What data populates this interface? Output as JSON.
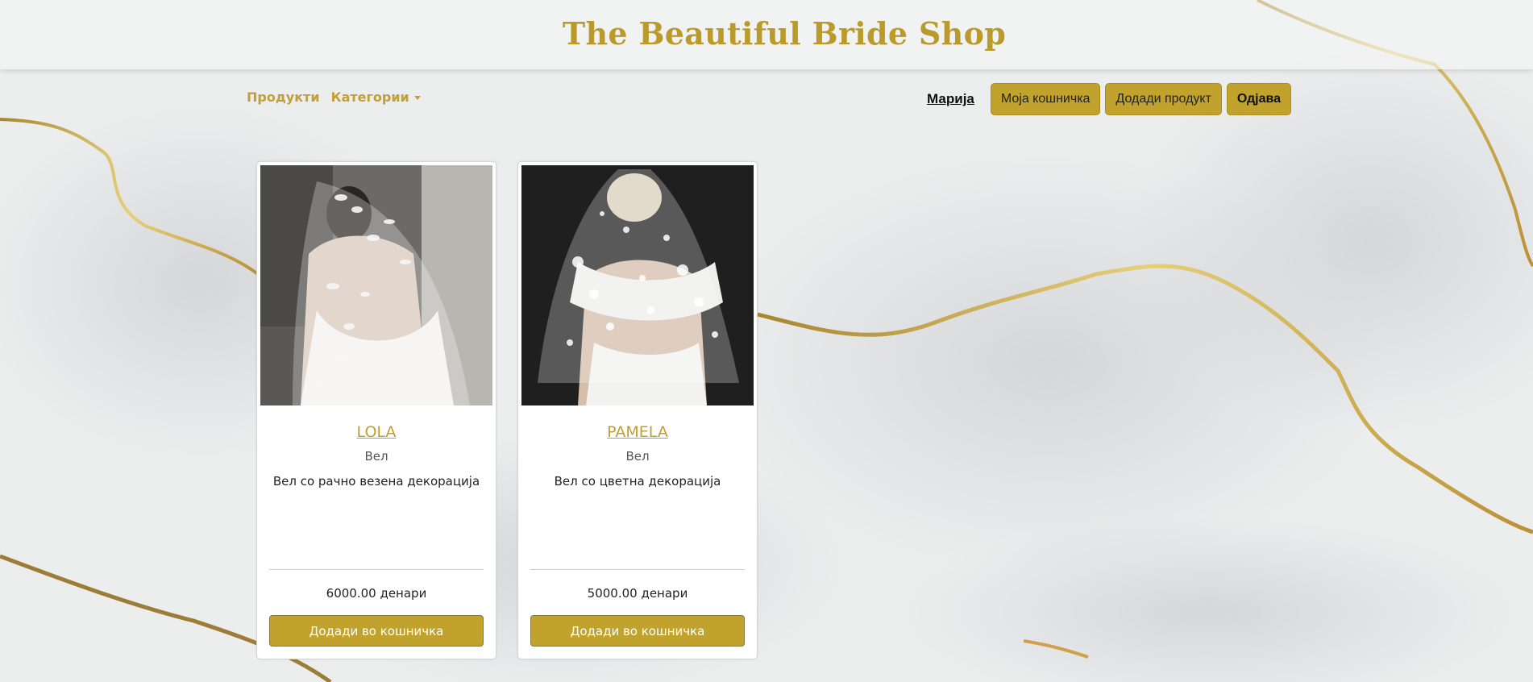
{
  "header": {
    "title": "The Beautiful Bride Shop"
  },
  "nav": {
    "products": "Продукти",
    "categories": "Категории"
  },
  "user_nav": {
    "username": "Марија",
    "cart": "Моја кошничка",
    "add_product": "Додади продукт",
    "logout": "Одјава"
  },
  "products": [
    {
      "name": "LOLA",
      "category": "Вел",
      "description": "Вел со рачно везена декорација",
      "price": "6000.00 денари",
      "add_to_cart": "Додади во кошничка"
    },
    {
      "name": "PAMELA",
      "category": "Вел",
      "description": "Вел со цветна декорација",
      "price": "5000.00 денари",
      "add_to_cart": "Додади во кошничка"
    }
  ],
  "colors": {
    "accent": "#c0a22d",
    "title_gold": "#b99a2a"
  }
}
